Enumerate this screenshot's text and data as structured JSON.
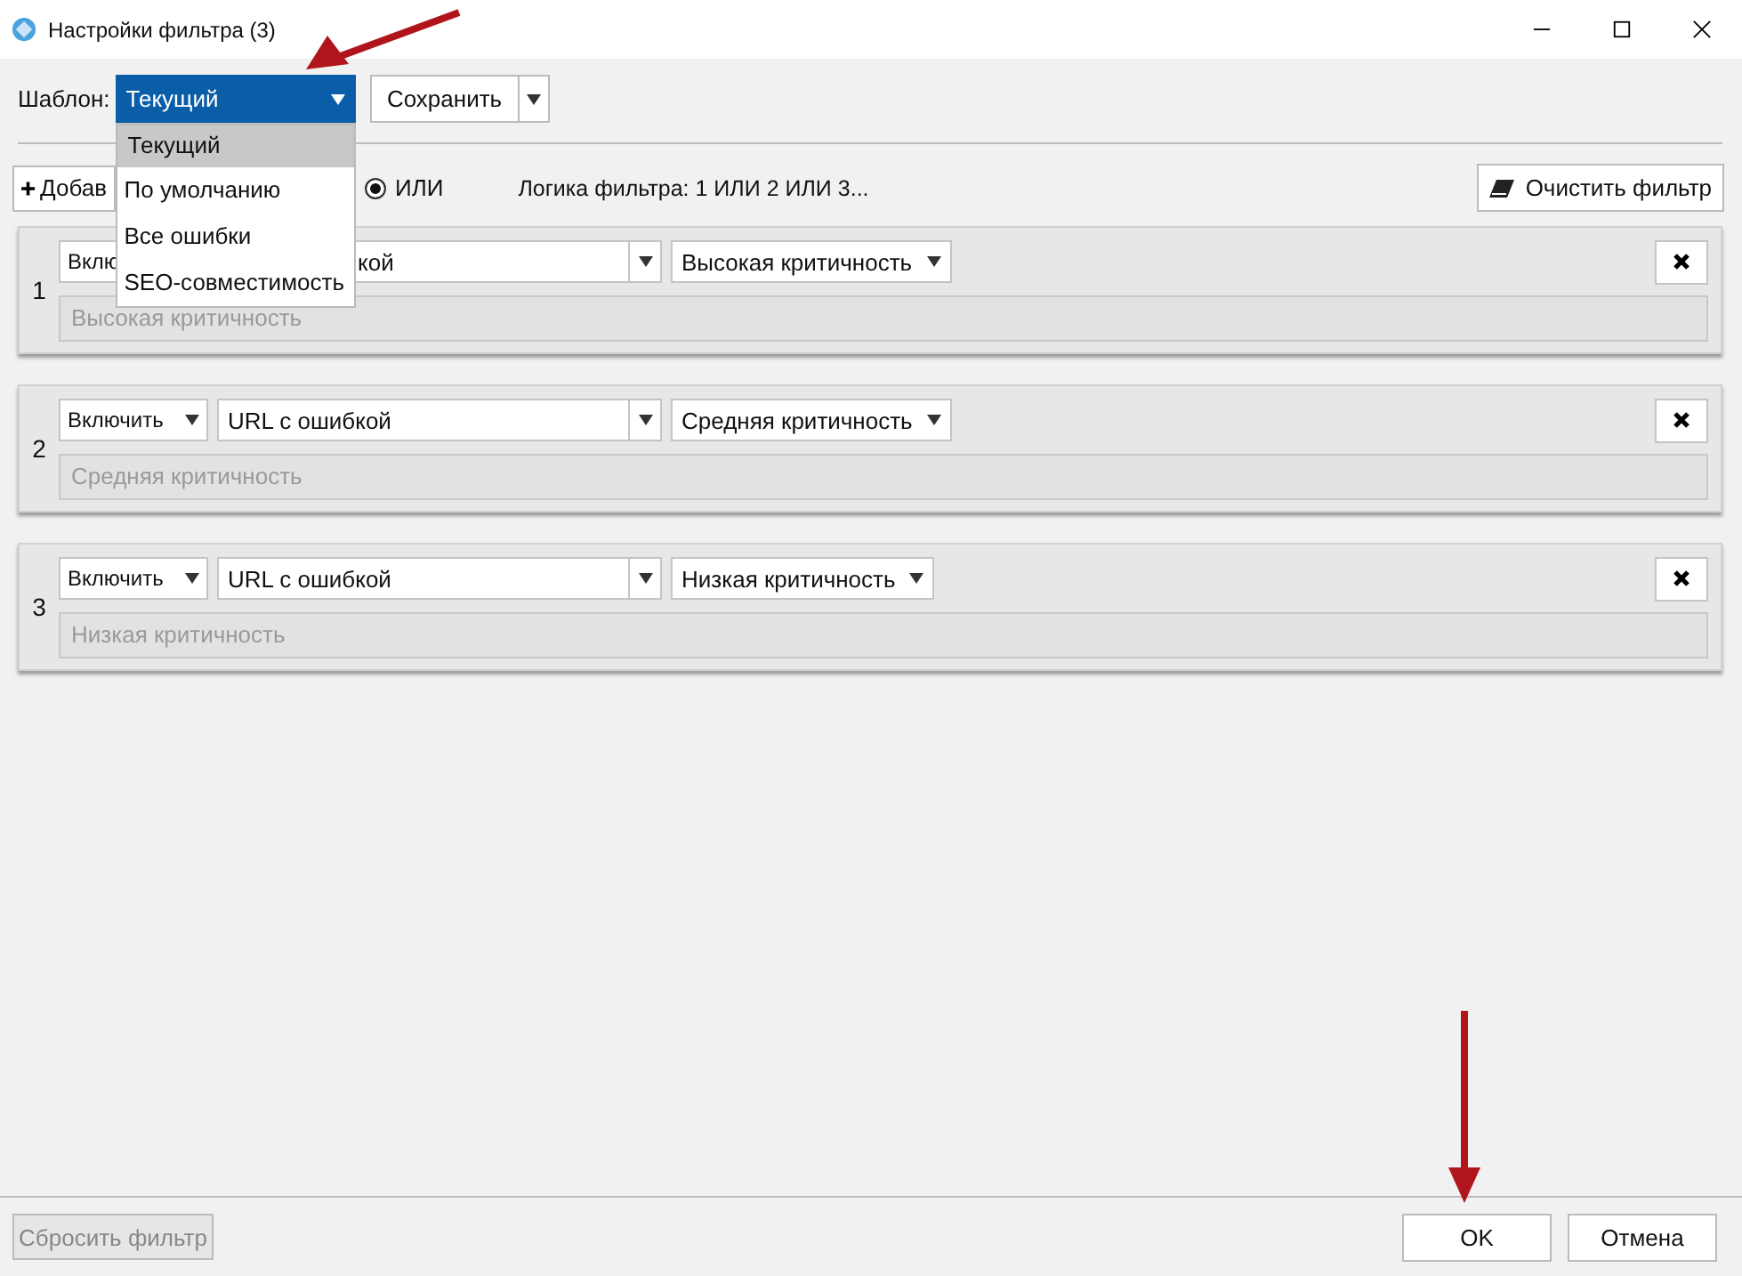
{
  "window": {
    "title": "Настройки фильтра (3)"
  },
  "template": {
    "label": "Шаблон:",
    "value": "Текущий",
    "save": "Сохранить",
    "expanded": true,
    "options": [
      {
        "label": "Текущий",
        "selected": true
      },
      {
        "label": "По умолчанию",
        "selected": false
      },
      {
        "label": "Все ошибки",
        "selected": false
      },
      {
        "label": "SEO-совместимость",
        "selected": false
      }
    ]
  },
  "toolbar": {
    "add": "Добав",
    "logic_radio": {
      "label": "ИЛИ",
      "selected": true
    },
    "logic": "Логика фильтра: 1 ИЛИ 2 ИЛИ 3...",
    "clear": "Очистить фильтр"
  },
  "rules": [
    {
      "number": "1",
      "obscured": true,
      "mode": "Вклю",
      "field": "кой",
      "severity": "Высокая критичность",
      "placeholder": "Высокая критичность"
    },
    {
      "number": "2",
      "obscured": false,
      "mode": "Включить",
      "field": "URL с ошибкой",
      "severity": "Средняя критичность",
      "placeholder": "Средняя критичность"
    },
    {
      "number": "3",
      "obscured": false,
      "mode": "Включить",
      "field": "URL с ошибкой",
      "severity": "Низкая критичность",
      "placeholder": "Низкая критичность"
    }
  ],
  "footer": {
    "reset": {
      "label": "Сбросить фильтр",
      "disabled": true
    },
    "ok": "OK",
    "cancel": "Отмена"
  }
}
